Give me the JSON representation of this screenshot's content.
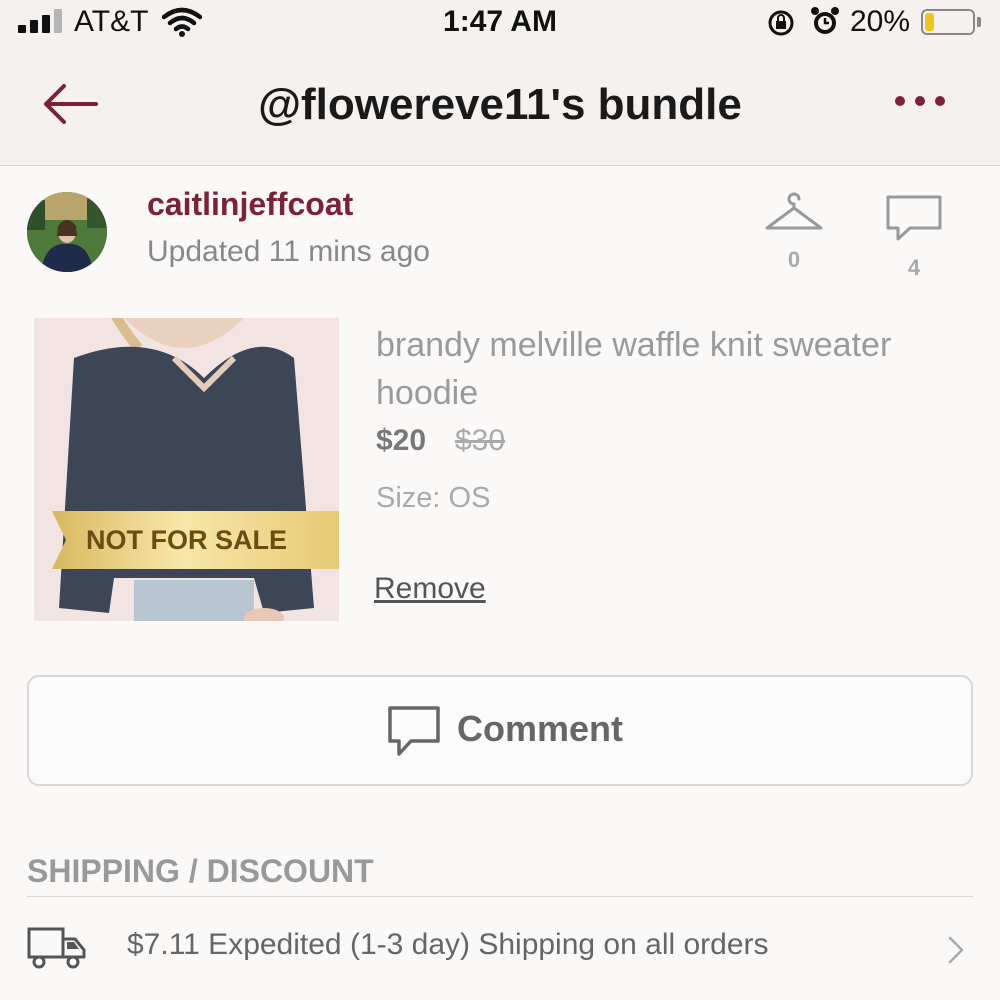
{
  "status_bar": {
    "carrier": "AT&T",
    "time": "1:47 AM",
    "battery_percent": "20%",
    "battery_level": 0.2,
    "icons": [
      "cellular-signal-icon",
      "wifi-icon",
      "rotation-lock-icon",
      "alarm-icon",
      "battery-icon"
    ]
  },
  "header": {
    "title": "@flowereve11's bundle",
    "back_icon": "arrow-left-icon",
    "more_icon": "more-dots-icon",
    "accent_color": "#7d2137"
  },
  "seller": {
    "username": "caitlinjeffcoat",
    "updated": "Updated 11 mins ago",
    "likes_count": "0",
    "comments_count": "4"
  },
  "item": {
    "title": "brandy melville waffle knit sweater hoodie",
    "price": "$20",
    "original_price": "$30",
    "size": "Size: OS",
    "badge": "NOT FOR SALE",
    "remove_label": "Remove"
  },
  "comment_button": {
    "label": "Comment"
  },
  "shipping": {
    "section_title": "SHIPPING / DISCOUNT",
    "text": "$7.11 Expedited (1-3 day) Shipping on all orders"
  }
}
